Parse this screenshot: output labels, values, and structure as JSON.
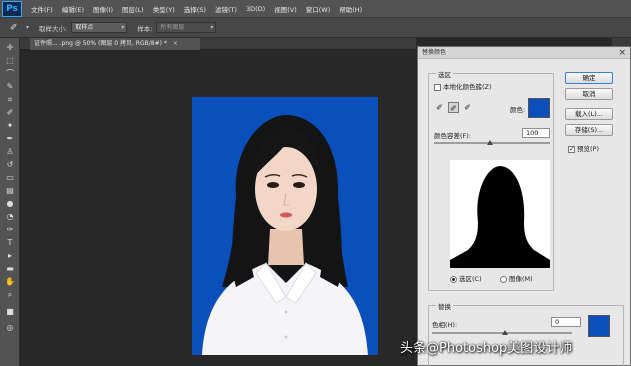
{
  "app": {
    "logo": "Ps",
    "menus": [
      "文件(F)",
      "编辑(E)",
      "图像(I)",
      "图层(L)",
      "类型(Y)",
      "选择(S)",
      "滤镜(T)",
      "3D(D)",
      "视图(V)",
      "窗口(W)",
      "帮助(H)"
    ]
  },
  "options": {
    "sample_size_label": "取样大小:",
    "sample_size_value": "取样点",
    "sample_label": "样本:",
    "sample_value": "所有图层"
  },
  "document": {
    "tab_label": "证件照... .png @ 50% (图层 0 拷贝, RGB/8#) *",
    "tab_close": "×",
    "background_color": "#0a4fba"
  },
  "dialog": {
    "title": "替换颜色",
    "close": "×",
    "selection_group": "选区",
    "localized_checkbox": "本地化颜色簇(Z)",
    "localized_checked": false,
    "color_label": "颜色:",
    "selected_color": "#0a4fba",
    "fuzziness_label": "颜色容差(F):",
    "fuzziness_value": "100",
    "radio_selection": "选区(C)",
    "radio_image": "图像(M)",
    "selected_mode": "selection",
    "replace_group": "替换",
    "hue_label": "色相(H):",
    "hue_value": "0",
    "replace_color": "#0a4fba",
    "buttons": {
      "ok": "确定",
      "cancel": "取消",
      "load": "载入(L)...",
      "save": "存储(S)...",
      "preview": "预览(P)"
    },
    "preview_checked": true
  },
  "watermark": "头条@Photoshop美图设计师"
}
